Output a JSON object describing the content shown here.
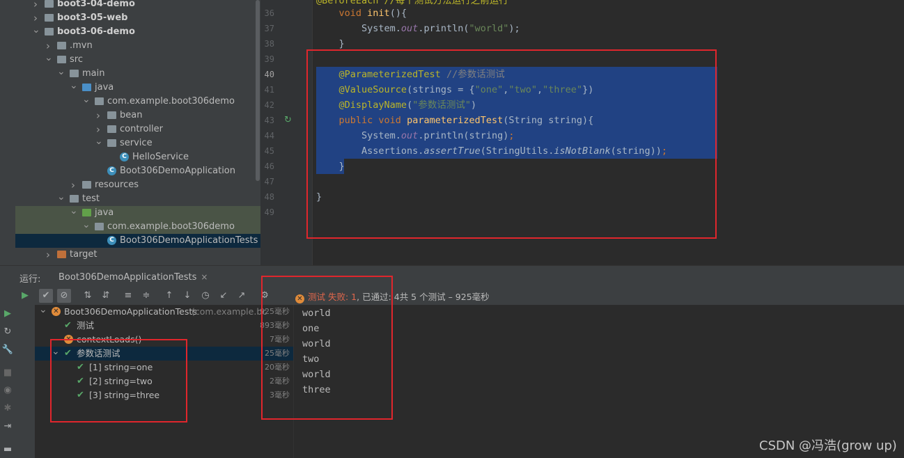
{
  "project_tree": [
    {
      "label": "boot3-04-demo",
      "indent": 0,
      "arrow": "right",
      "icon": "module",
      "bold": true
    },
    {
      "label": "boot3-05-web",
      "indent": 0,
      "arrow": "right",
      "icon": "module",
      "bold": true
    },
    {
      "label": "boot3-06-demo",
      "indent": 0,
      "arrow": "down",
      "icon": "module",
      "bold": true
    },
    {
      "label": ".mvn",
      "indent": 1,
      "arrow": "right",
      "icon": "folder"
    },
    {
      "label": "src",
      "indent": 1,
      "arrow": "down",
      "icon": "folder"
    },
    {
      "label": "main",
      "indent": 2,
      "arrow": "down",
      "icon": "folder"
    },
    {
      "label": "java",
      "indent": 3,
      "arrow": "down",
      "icon": "folder-blue"
    },
    {
      "label": "com.example.boot306demo",
      "indent": 4,
      "arrow": "down",
      "icon": "package"
    },
    {
      "label": "bean",
      "indent": 5,
      "arrow": "right",
      "icon": "package"
    },
    {
      "label": "controller",
      "indent": 5,
      "arrow": "right",
      "icon": "package"
    },
    {
      "label": "service",
      "indent": 5,
      "arrow": "down",
      "icon": "package"
    },
    {
      "label": "HelloService",
      "indent": 6,
      "arrow": "",
      "icon": "class"
    },
    {
      "label": "Boot306DemoApplication",
      "indent": 5,
      "arrow": "",
      "icon": "class"
    },
    {
      "label": "resources",
      "indent": 3,
      "arrow": "right",
      "icon": "folder"
    },
    {
      "label": "test",
      "indent": 2,
      "arrow": "down",
      "icon": "folder"
    },
    {
      "label": "java",
      "indent": 3,
      "arrow": "down",
      "icon": "folder-green",
      "highlight": "test"
    },
    {
      "label": "com.example.boot306demo",
      "indent": 4,
      "arrow": "down",
      "icon": "package",
      "highlight": "test"
    },
    {
      "label": "Boot306DemoApplicationTests",
      "indent": 5,
      "arrow": "",
      "icon": "class",
      "highlight": "file"
    },
    {
      "label": "target",
      "indent": 1,
      "arrow": "right",
      "icon": "folder-orange"
    }
  ],
  "editor": {
    "line_numbers": [
      "36",
      "37",
      "38",
      "39",
      "40",
      "41",
      "42",
      "43",
      "44",
      "45",
      "46",
      "47",
      "48",
      "49"
    ],
    "current_line": "40",
    "partial_top_line": "@BeforeEach //每个测试方法运行之前运行"
  },
  "run_panel": {
    "run_label": "运行:",
    "tab_label": "Boot306DemoApplicationTests",
    "tab_close": "×",
    "status_fail": "测试 失败: 1",
    "status_rest": ", 已通过: 4共 5 个测试 – 925毫秒",
    "tests": [
      {
        "label": "Boot306DemoApplicationTests",
        "extra": " (com.example.bc",
        "time": "925毫秒",
        "status": "fail",
        "indent": 0,
        "arrow": "down"
      },
      {
        "label": "测试",
        "extra": "",
        "time": "893毫秒",
        "status": "ok",
        "indent": 1,
        "arrow": ""
      },
      {
        "label": "contextLoads()",
        "extra": "",
        "time": "7毫秒",
        "status": "fail",
        "indent": 1,
        "arrow": ""
      },
      {
        "label": "参数话测试",
        "extra": "",
        "time": "25毫秒",
        "status": "ok",
        "indent": 1,
        "arrow": "down",
        "selected": true
      },
      {
        "label": "[1] string=one",
        "extra": "",
        "time": "20毫秒",
        "status": "ok",
        "indent": 2,
        "arrow": ""
      },
      {
        "label": "[2] string=two",
        "extra": "",
        "time": "2毫秒",
        "status": "ok",
        "indent": 2,
        "arrow": ""
      },
      {
        "label": "[3] string=three",
        "extra": "",
        "time": "3毫秒",
        "status": "ok",
        "indent": 2,
        "arrow": ""
      }
    ],
    "console": [
      "world",
      "one",
      "world",
      "two",
      "world",
      "three"
    ]
  },
  "watermark": "CSDN @冯浩(grow up)",
  "colors": {
    "selection": "#214283",
    "annotation": "#bbb529",
    "keyword": "#cc7832",
    "string": "#6a8759",
    "method": "#ffc66d",
    "pass": "#59a869",
    "fail": "#e0674c",
    "red_box": "#e0262c"
  }
}
